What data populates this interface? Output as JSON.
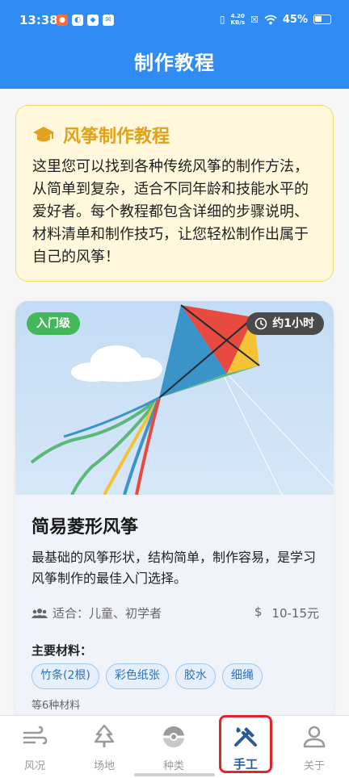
{
  "status": {
    "time": "13:38",
    "notification_icons": [
      "app-icon-1",
      "app-icon-2",
      "app-icon-3",
      "mail-icon"
    ],
    "speed_value": "4.20",
    "speed_unit": "KB/s",
    "battery": "45%"
  },
  "header": {
    "title": "制作教程"
  },
  "intro": {
    "icon": "graduation-cap-icon",
    "title": "风筝制作教程",
    "text": "这里您可以找到各种传统风筝的制作方法，从简单到复杂，适合不同年龄和技能水平的爱好者。每个教程都包含详细的步骤说明、材料清单和制作技巧，让您轻松制作出属于自己的风筝！"
  },
  "tutorial": {
    "level_badge": "入门级",
    "time_badge": "约1小时",
    "title": "简易菱形风筝",
    "description": "最基础的风筝形状，结构简单，制作容易，是学习风筝制作的最佳入门选择。",
    "suitable": "适合：儿童、初学者",
    "price_symbol": "$",
    "price": "10-15元",
    "materials_title": "主要材料：",
    "materials": [
      "竹条(2根)",
      "彩色纸张",
      "胶水",
      "细绳"
    ],
    "materials_more": "等6种材料"
  },
  "nav": {
    "items": [
      {
        "label": "风况",
        "icon": "wind-icon"
      },
      {
        "label": "场地",
        "icon": "tree-icon"
      },
      {
        "label": "种类",
        "icon": "pokeball-icon"
      },
      {
        "label": "手工",
        "icon": "tools-icon"
      },
      {
        "label": "关于",
        "icon": "person-icon"
      }
    ],
    "active_index": 3
  },
  "colors": {
    "primary": "#2f8cf3",
    "intro_title": "#e0a21a",
    "badge_green": "#43b85a",
    "active_nav": "#2a5d8f",
    "highlight_border": "#e0252b"
  }
}
